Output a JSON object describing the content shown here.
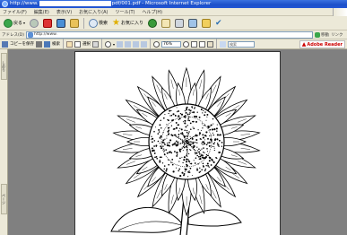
{
  "window": {
    "title_prefix": "http://www.",
    "title_suffix": "pdf/001.pdf - Microsoft Internet Explorer"
  },
  "menu": [
    "ファイル(F)",
    "編集(E)",
    "表示(V)",
    "お気に入り(A)",
    "ツール(T)",
    "ヘルプ(H)"
  ],
  "nav": {
    "back_label": "戻る",
    "search_label": "検索",
    "favorites_label": "お気に入り"
  },
  "address": {
    "label": "アドレス(D)",
    "value": "http://www.",
    "go_label": "移動",
    "links_label": "リンク"
  },
  "pdf_toolbar": {
    "save_copy_label": "コピーを保存",
    "search_label": "検索",
    "select_label": "選択",
    "zoom_value": "76%",
    "find_placeholder": "検索",
    "adobe_label": "Adobe Reader"
  },
  "left_tabs": [
    "しおり",
    "ページ"
  ],
  "colors": {
    "titlebar": "#2458d6",
    "chrome": "#ece9d8",
    "document_bg": "#808080"
  }
}
